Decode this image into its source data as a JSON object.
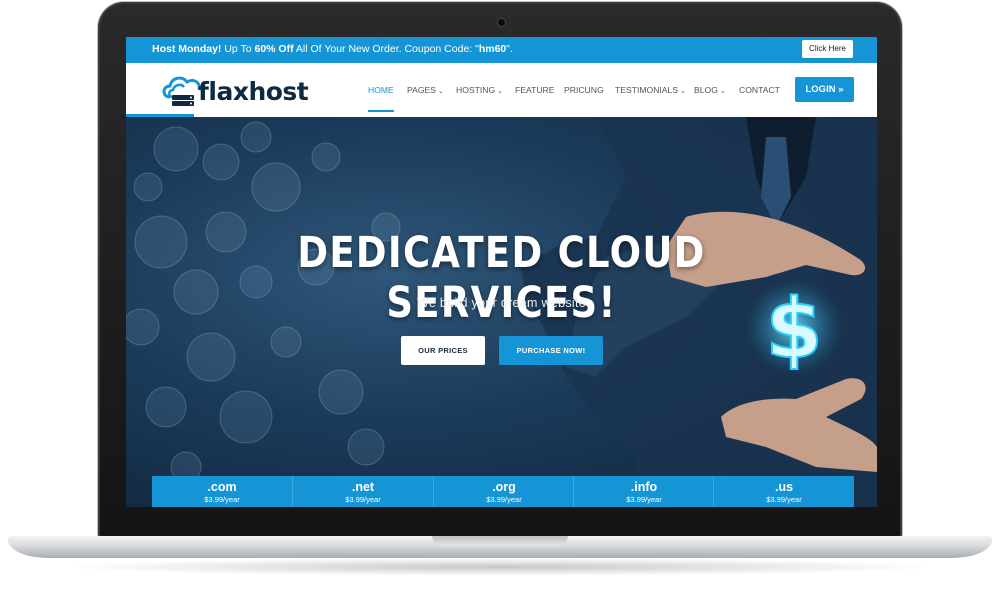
{
  "topbar": {
    "promo_lead": "Host Monday!",
    "promo_mid": " Up To ",
    "promo_discount": "60% Off",
    "promo_tail": " All Of Your New Order. Coupon Code: \"",
    "promo_code": "hm60",
    "promo_end": "\".",
    "cta_label": "Click Here"
  },
  "brand": {
    "logo_part1": "flax",
    "logo_part2": "host"
  },
  "nav": {
    "items": [
      {
        "label": "HOME"
      },
      {
        "label": "PAGES"
      },
      {
        "label": "HOSTING"
      },
      {
        "label": "FEATURE"
      },
      {
        "label": "PRICUNG"
      },
      {
        "label": "TESTIMONIALS"
      },
      {
        "label": "BLOG"
      },
      {
        "label": "CONTACT"
      }
    ],
    "login_label": "LOGIN"
  },
  "hero": {
    "title": "DEDICATED CLOUD SERVICES!",
    "subtitle": "We build your dream website",
    "primary_button": "OUR PRICES",
    "secondary_button": "PURCHASE NOW!",
    "symbol": "$"
  },
  "domains": [
    {
      "tld": ".com",
      "price": "$3.99/year"
    },
    {
      "tld": ".net",
      "price": "$3.99/year"
    },
    {
      "tld": ".org",
      "price": "$3.99/year"
    },
    {
      "tld": ".info",
      "price": "$3.99/year"
    },
    {
      "tld": ".us",
      "price": "$3.99/year"
    }
  ],
  "colors": {
    "accent": "#1595d6",
    "hero_bg": "#1b3a5a",
    "logo_dark": "#0d2a44"
  },
  "icons": {
    "logo": "cloud-server-icon",
    "caret": "chevron-down-icon",
    "login": "double-chevron-right-icon",
    "camera": "camera-dot"
  }
}
